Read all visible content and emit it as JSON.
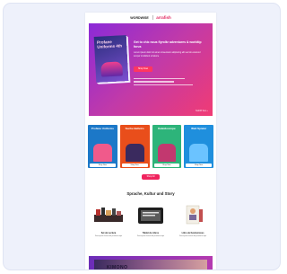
{
  "header": {
    "brand_left": "WORDWISE",
    "brand_right": "arrafish"
  },
  "hero": {
    "book_title": "Profane Uniforms 4th",
    "headline": "Get to chic nous flyrolkr adventures & worldtip forus",
    "body": "Lorem ipsum dolor sit amet consectetur adipiscing elit sed do eiusmod tempor incididunt ut labore",
    "cta": "Shop Now",
    "foot": "SHOP ALL ›"
  },
  "covers": [
    {
      "title": "Profane Uniforms",
      "label": "Shop Now",
      "color": "#1c78c8",
      "figure": "#f05a8b"
    },
    {
      "title": "Suche Belletro",
      "label": "Shop Now",
      "color": "#e94e1b",
      "figure": "#3a2a5e"
    },
    {
      "title": "Kaleidoscope",
      "label": "Shop Now",
      "color": "#2db47a",
      "figure": "#c2386f"
    },
    {
      "title": "Welt Spieler",
      "label": "Shop Now",
      "color": "#1f8fdd",
      "figure": "#6bc3ff"
    }
  ],
  "main_cta": "Shop All",
  "section_title": "Sprache, Kultur und Story",
  "products": [
    {
      "name": "Set de Lectura",
      "desc": "Descripción breve del producto aquí"
    },
    {
      "name": "Tablet de Libros",
      "desc": "Descripción breve del producto aquí"
    },
    {
      "name": "Libro de Ilustraciones",
      "desc": "Descripción breve del producto aquí"
    }
  ],
  "footer": {
    "word": "KIMONO"
  }
}
